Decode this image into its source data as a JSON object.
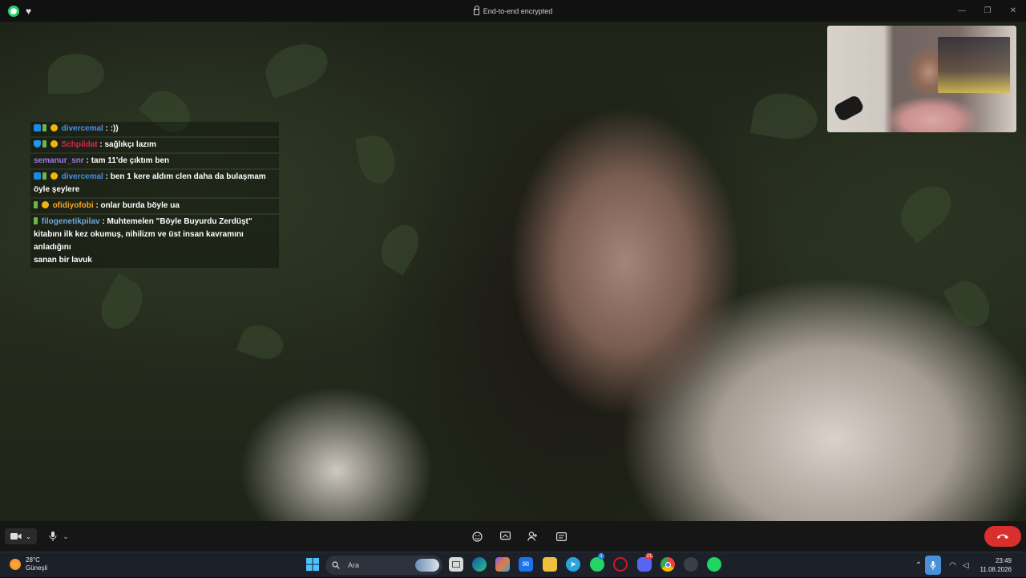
{
  "window": {
    "title": "End-to-end encrypted",
    "controls": [
      "minimize",
      "maximize",
      "close"
    ]
  },
  "chat": [
    {
      "badges": [
        "prime-icon",
        "leaf-badge-icon",
        "gold-badge-icon"
      ],
      "user": "divercemal",
      "user_color": "#4a90e2",
      "text": " : :))",
      "cont": []
    },
    {
      "badges": [
        "gem-icon",
        "leaf-badge-icon",
        "gold-badge-icon"
      ],
      "user": "Schpildat",
      "user_color": "#e0224e",
      "text": " : sağlıkçı lazım",
      "cont": []
    },
    {
      "badges": [],
      "user": "semanur_snr",
      "user_color": "#9f7aea",
      "text": " : tam 11'de çıktım ben",
      "cont": []
    },
    {
      "badges": [
        "prime-icon",
        "leaf-badge-icon",
        "gold-badge-icon"
      ],
      "user": "divercemal",
      "user_color": "#4a90e2",
      "text": " : ben 1 kere aldım clen daha da bulaşmam",
      "cont": [
        "öyle şeylere"
      ]
    },
    {
      "badges": [
        "leaf-badge-icon",
        "gold-badge-icon"
      ],
      "user": "ofidiyofobi",
      "user_color": "#f5a623",
      "text": " : onlar burda böyle ua",
      "cont": []
    },
    {
      "badges": [
        "leaf-badge-icon"
      ],
      "user": "filogenetikpilav",
      "user_color": "#6fa8dc",
      "text": " : Muhtemelen \"Böyle Buyurdu Zerdüşt\"",
      "cont": [
        "kitabını ilk kez okumuş, nihilizm ve üst insan kavramını anladığını",
        "sanan bir lavuk"
      ]
    }
  ],
  "call_controls": {
    "camera": "video-camera-icon",
    "mic": "microphone-icon",
    "center": [
      "emoji-icon",
      "screen-share-icon",
      "add-person-icon",
      "more-icon"
    ],
    "end": "end-call-icon"
  },
  "taskbar": {
    "weather_temp": "28°C",
    "weather_desc": "Güneşli",
    "search_placeholder": "Ara",
    "whatsapp_badge": "1",
    "discord_badge": "21",
    "time": "23:49",
    "date": "11.08.2026"
  },
  "colors": {
    "end_call": "#d9302d",
    "whatsapp": "#25D366",
    "taskbar": "#1c2029"
  }
}
